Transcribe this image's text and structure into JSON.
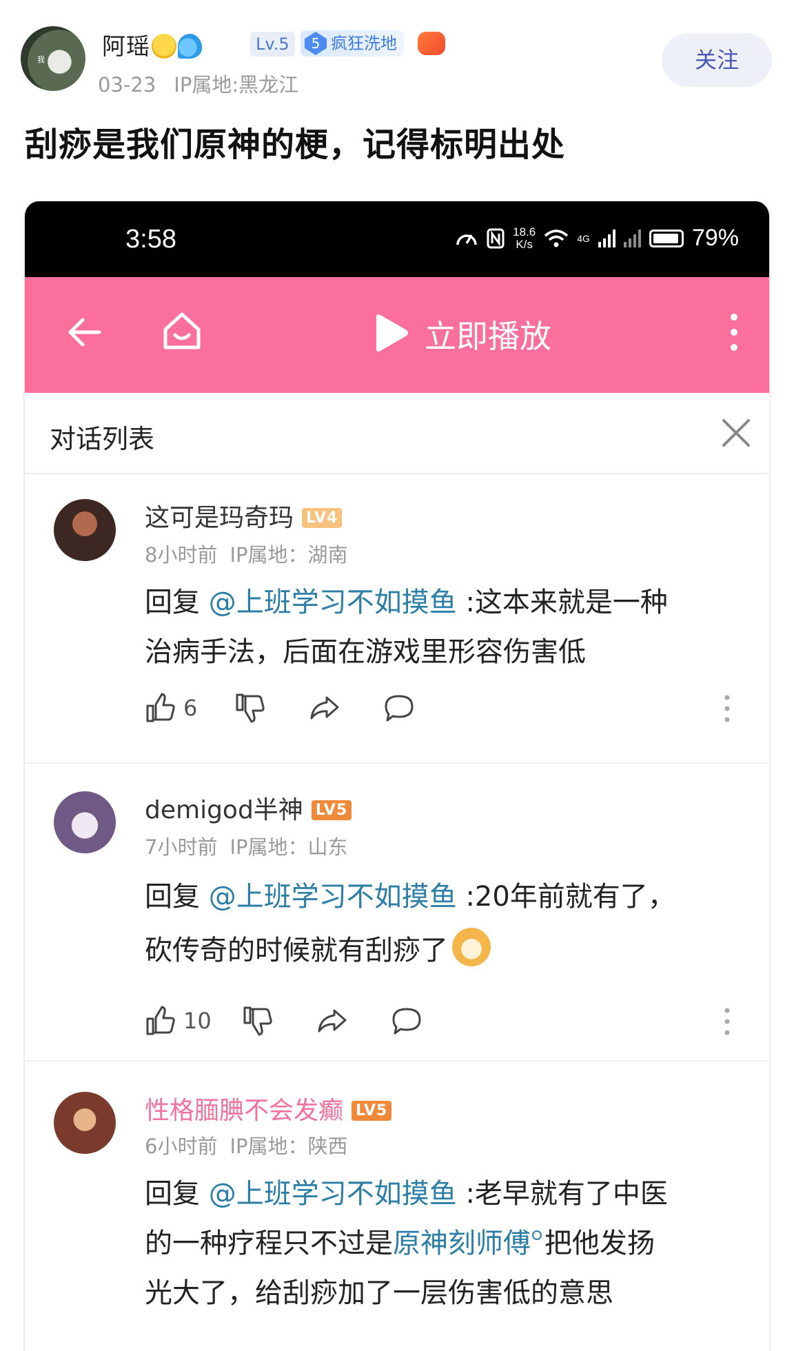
{
  "post": {
    "author": "阿瑶",
    "level": "Lv.5",
    "fan_badge_level": "5",
    "fan_badge_label": "疯狂洗地",
    "date": "03-23",
    "ip": "IP属地:黑龙江",
    "follow_label": "关注",
    "title": "刮痧是我们原神的梗，记得标明出处"
  },
  "screenshot": {
    "status_bar": {
      "time": "3:58",
      "speed_top": "18.6",
      "speed_bottom": "K/s",
      "network": "4G",
      "battery": "79%"
    },
    "app_bar": {
      "play_label": "立即播放"
    },
    "conversation": {
      "title": "对话列表"
    },
    "comments": [
      {
        "name": "这可是玛奇玛",
        "level": "LV4",
        "time": "8小时前",
        "ip": "IP属地：湖南",
        "reply_prefix": "回复",
        "mention": "@上班学习不如摸鱼",
        "line1": ":这本来就是一种",
        "line2": "治病手法，后面在游戏里形容伤害低",
        "likes": "6"
      },
      {
        "name": "demigod半神",
        "level": "LV5",
        "time": "7小时前",
        "ip": "IP属地：山东",
        "reply_prefix": "回复",
        "mention": "@上班学习不如摸鱼",
        "line1": ":20年前就有了，",
        "line2": "砍传奇的时候就有刮痧了",
        "likes": "10"
      },
      {
        "name": "性格腼腆不会发癫",
        "level": "LV5",
        "time": "6小时前",
        "ip": "IP属地：陕西",
        "reply_prefix": "回复",
        "mention": "@上班学习不如摸鱼",
        "line1": ":老早就有了中医",
        "line2_pre": "的一种疗程只不过是",
        "line2_link": "原神刻师傅",
        "line2_post": "把他发扬",
        "line3": "光大了，给刮痧加了一层伤害低的意思"
      }
    ]
  },
  "colors": {
    "app_bar": "#fb6f9c",
    "mention": "#2b7ea6",
    "follow_text": "#4956b8",
    "pink_name": "#f1739c"
  },
  "icons": [
    "back-arrow-icon",
    "home-icon",
    "play-icon",
    "more-vertical-icon",
    "close-icon",
    "thumbs-up-icon",
    "thumbs-down-icon",
    "share-icon",
    "comment-icon"
  ]
}
